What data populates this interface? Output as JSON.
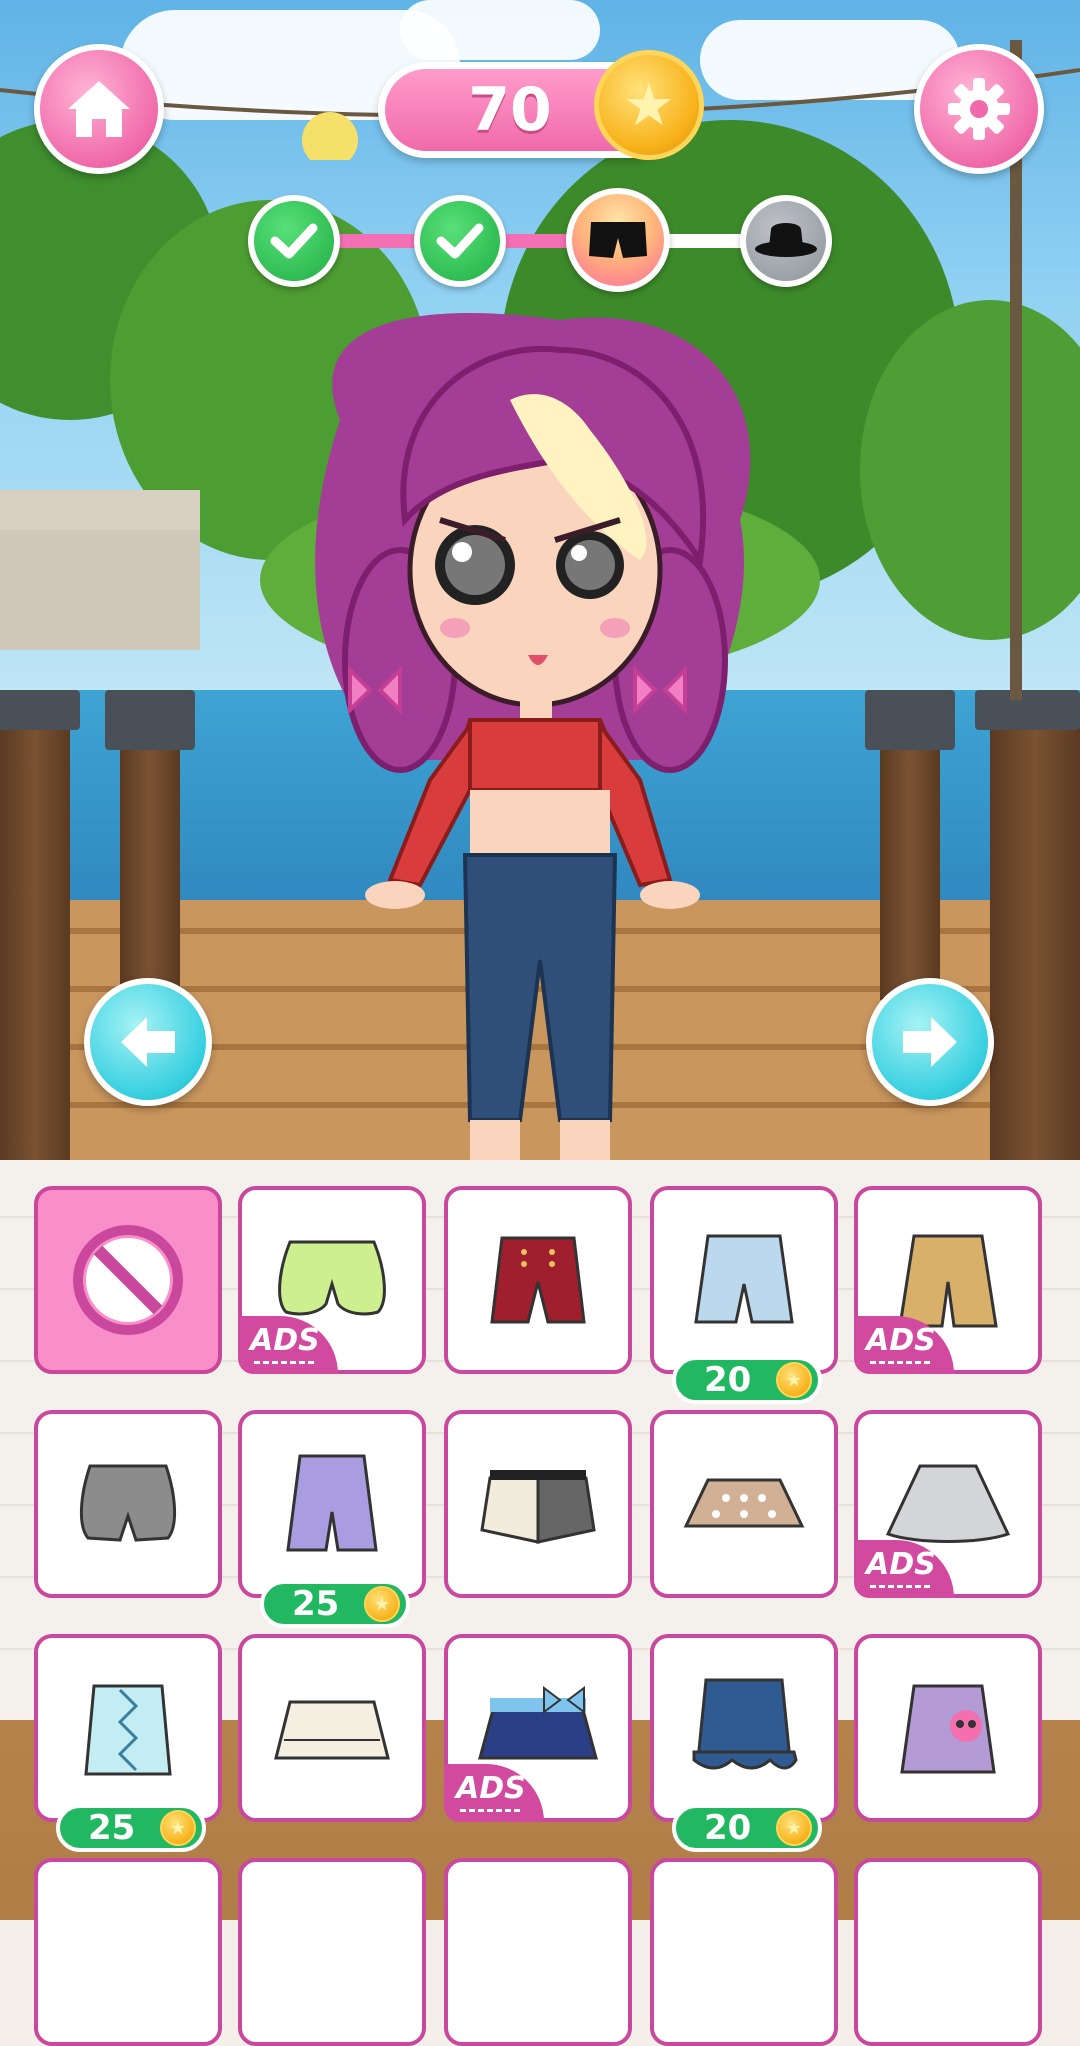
{
  "hud": {
    "home_icon": "home-icon",
    "coins": "70",
    "coin_icon": "star-coin-icon",
    "settings_icon": "gear-icon",
    "progress_steps": [
      {
        "state": "done",
        "icon": "check-icon"
      },
      {
        "state": "done",
        "icon": "check-icon"
      },
      {
        "state": "active",
        "icon": "shorts-icon"
      },
      {
        "state": "locked",
        "icon": "hat-icon"
      }
    ],
    "prev_icon": "arrow-left-icon",
    "next_icon": "arrow-right-icon"
  },
  "colors": {
    "pink": "#f06aaa",
    "cyan": "#36cfe0",
    "green": "#22b862",
    "item_border": "#c9479c",
    "ads_badge": "#d24aa0"
  },
  "items": [
    {
      "name": "none",
      "icon": "no-item-icon",
      "badge": null
    },
    {
      "name": "lime-bloomers",
      "icon": "lime-bloomers-icon",
      "badge": "ads",
      "label": "ADS"
    },
    {
      "name": "red-shorts",
      "icon": "red-shorts-icon",
      "badge": null
    },
    {
      "name": "denim-shorts",
      "icon": "denim-shorts-icon",
      "badge": "price",
      "price": "20"
    },
    {
      "name": "tan-shorts",
      "icon": "tan-shorts-icon",
      "badge": "ads",
      "label": "ADS"
    },
    {
      "name": "gray-shorts",
      "icon": "gray-shorts-icon",
      "badge": null
    },
    {
      "name": "lavender-shorts",
      "icon": "lavender-shorts-icon",
      "badge": "price",
      "price": "25"
    },
    {
      "name": "two-tone-skirt",
      "icon": "two-tone-skirt-icon",
      "badge": null
    },
    {
      "name": "dotted-skirt",
      "icon": "dotted-skirt-icon",
      "badge": null
    },
    {
      "name": "gray-skirt",
      "icon": "gray-skirt-icon",
      "badge": "ads",
      "label": "ADS"
    },
    {
      "name": "aqua-laced-skirt",
      "icon": "aqua-skirt-icon",
      "badge": "price",
      "price": "25"
    },
    {
      "name": "cream-ruffle-skirt",
      "icon": "cream-skirt-icon",
      "badge": null
    },
    {
      "name": "navy-bow-skirt",
      "icon": "navy-bow-skirt-icon",
      "badge": "ads",
      "label": "ADS"
    },
    {
      "name": "denim-ruffle-skirt",
      "icon": "denim-skirt-icon",
      "badge": "price",
      "price": "20"
    },
    {
      "name": "purple-skull-skirt",
      "icon": "purple-skull-skirt-icon",
      "badge": null
    }
  ]
}
